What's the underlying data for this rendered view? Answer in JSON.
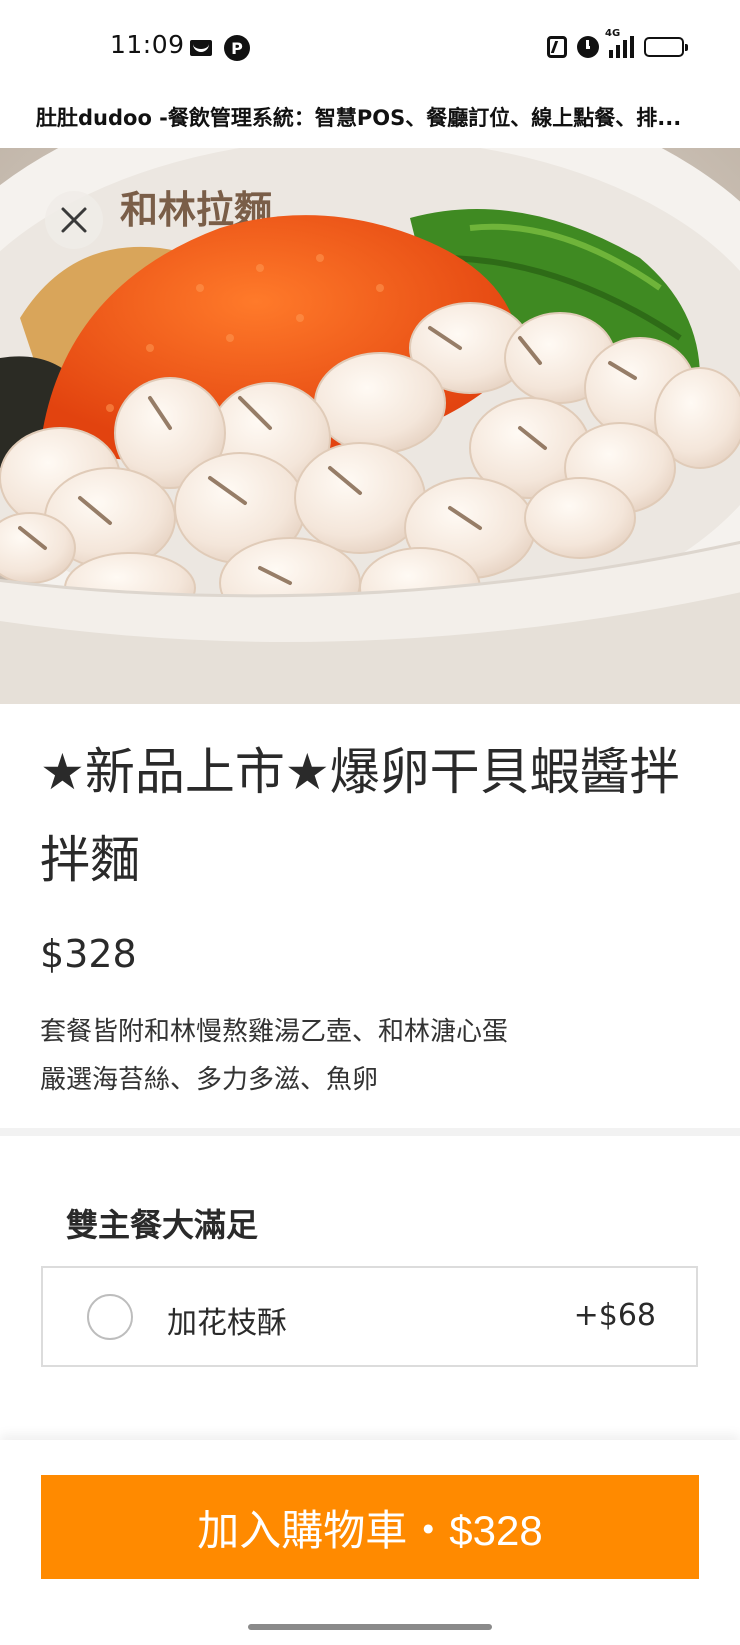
{
  "status_bar": {
    "time": "11:09",
    "left_icons": [
      "mail-icon",
      "parking-p-icon"
    ],
    "p_glyph": "P",
    "right_icons": [
      "nfc-icon",
      "alarm-icon",
      "signal-4g-icon",
      "battery-icon"
    ],
    "network": "4G"
  },
  "page": {
    "title": "肚肚dudoo -餐飲管理系統：智慧POS、餐廳訂位、線上點餐、排..."
  },
  "product": {
    "name": "★新品上市★爆卵干貝蝦醬拌拌麵",
    "price": "$328",
    "description": "套餐皆附和林慢熬雞湯乙壺、和林溏心蛋\n嚴選海苔絲、多力多滋、魚卵",
    "bowl_text": "和林拉麵"
  },
  "options": {
    "group_title": "雙主餐大滿足",
    "items": [
      {
        "label": "加花枝酥",
        "price": "+$68",
        "selected": false
      }
    ]
  },
  "cart": {
    "button_label": "加入購物車・$328"
  },
  "colors": {
    "accent": "#ff8a00",
    "roe": "#f0561a",
    "scallion": "#3f8a22"
  }
}
